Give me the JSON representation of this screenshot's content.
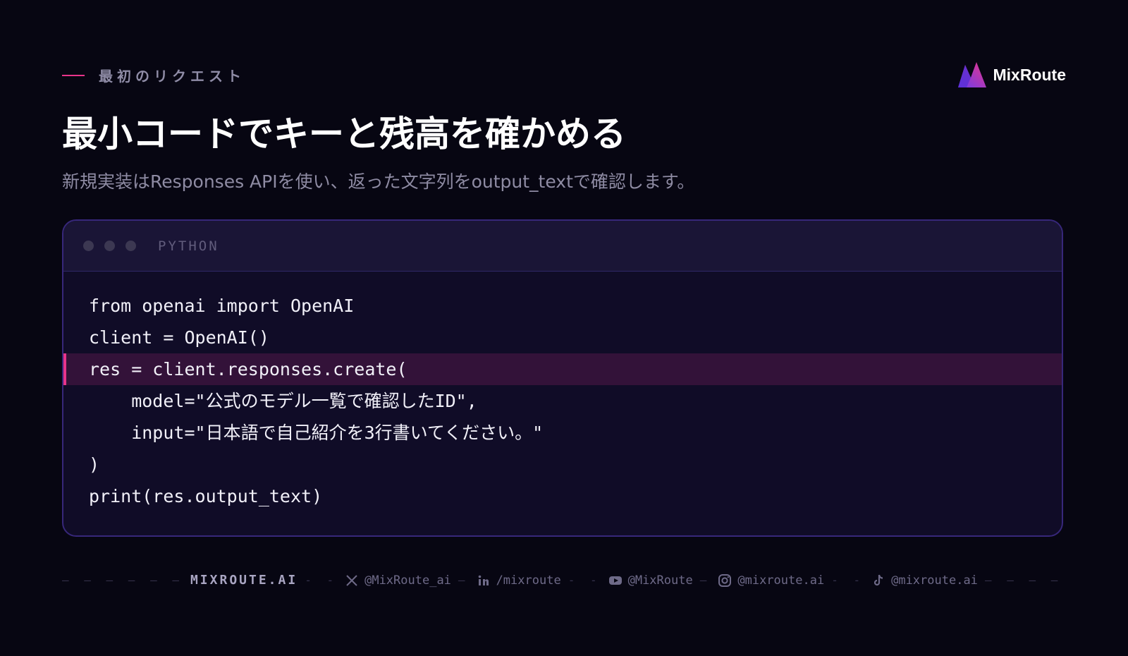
{
  "eyebrow": {
    "text": "最初のリクエスト"
  },
  "brand": {
    "name": "MixRoute"
  },
  "title": "最小コードでキーと残高を確かめる",
  "subtitle": "新規実装はResponses APIを使い、返った文字列をoutput_textで確認します。",
  "code": {
    "language": "PYTHON",
    "lines": [
      "from openai import OpenAI",
      "client = OpenAI()",
      "res = client.responses.create(",
      "    model=\"公式のモデル一覧で確認したID\",",
      "    input=\"日本語で自己紹介を3行書いてください。\"",
      ")",
      "print(res.output_text)"
    ],
    "highlighted_line": 3
  },
  "footer": {
    "brand": "MIXROUTE.AI",
    "socials": [
      {
        "icon": "x-icon",
        "label": "@MixRoute_ai"
      },
      {
        "icon": "linkedin-icon",
        "label": "/mixroute"
      },
      {
        "icon": "youtube-icon",
        "label": "@MixRoute"
      },
      {
        "icon": "instagram-icon",
        "label": "@mixroute.ai"
      },
      {
        "icon": "tiktok-icon",
        "label": "@mixroute.ai"
      }
    ]
  },
  "colors": {
    "background": "#070612",
    "accent": "#e8348a",
    "code_border": "#37277a",
    "highlight": "#331239"
  }
}
